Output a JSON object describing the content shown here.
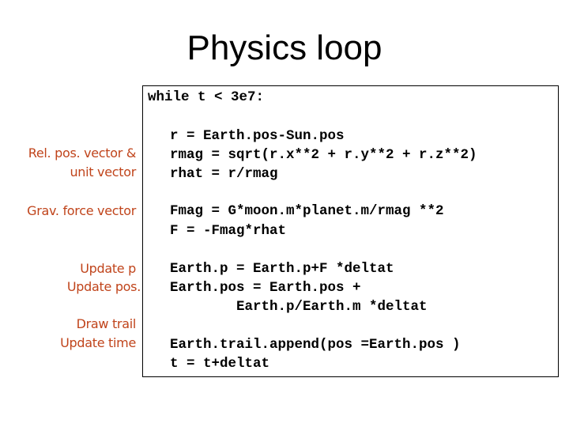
{
  "slide": {
    "title": "Physics loop",
    "label_color": "#c0441b",
    "code_lines": {
      "while": "while t < 3e7:",
      "r": "r = Earth.pos-Sun.pos",
      "rmag": "rmag = sqrt(r.x**2 + r.y**2 + r.z**2)",
      "rhat": "rhat = r/rmag",
      "fmag": "Fmag = G*moon.m*planet.m/rmag **2",
      "f": "F = -Fmag*rhat",
      "earth_p": "Earth.p = Earth.p+F *deltat",
      "earth_pos": "Earth.pos = Earth.pos +",
      "earth_pos_cont": "Earth.p/Earth.m *deltat",
      "trail": "Earth.trail.append(pos =Earth.pos )",
      "t": "t = t+deltat"
    },
    "annotations": {
      "rel_pos_1": "Rel. pos. vector &",
      "rel_pos_2": "unit vector",
      "grav_force": "Grav. force vector",
      "update_p": "Update p",
      "update_pos": "Update pos.",
      "draw_trail": "Draw trail",
      "update_time": "Update time"
    }
  }
}
